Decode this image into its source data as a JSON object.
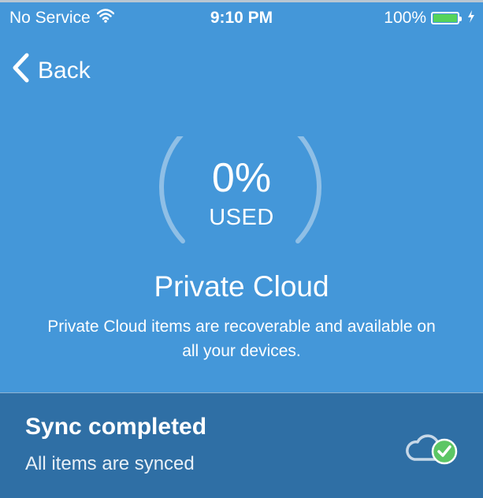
{
  "status_bar": {
    "carrier": "No Service",
    "time": "9:10 PM",
    "battery_pct": "100%",
    "battery_level": 1.0,
    "icons": [
      "wifi-icon",
      "battery-icon",
      "charging-bolt-icon"
    ]
  },
  "nav": {
    "back_label": "Back",
    "back_icon": "chevron-left-icon"
  },
  "usage": {
    "percent_text": "0%",
    "used_label": "USED",
    "used_fraction": 0.0
  },
  "cloud": {
    "title": "Private Cloud",
    "description": "Private Cloud items are recoverable and available on all your devices."
  },
  "sync": {
    "title": "Sync completed",
    "subtitle": "All items are synced",
    "icon": "cloud-check-icon"
  },
  "colors": {
    "header_blue": "#4497d9",
    "panel_blue": "#2f6fa5",
    "check_green": "#5cc665"
  }
}
